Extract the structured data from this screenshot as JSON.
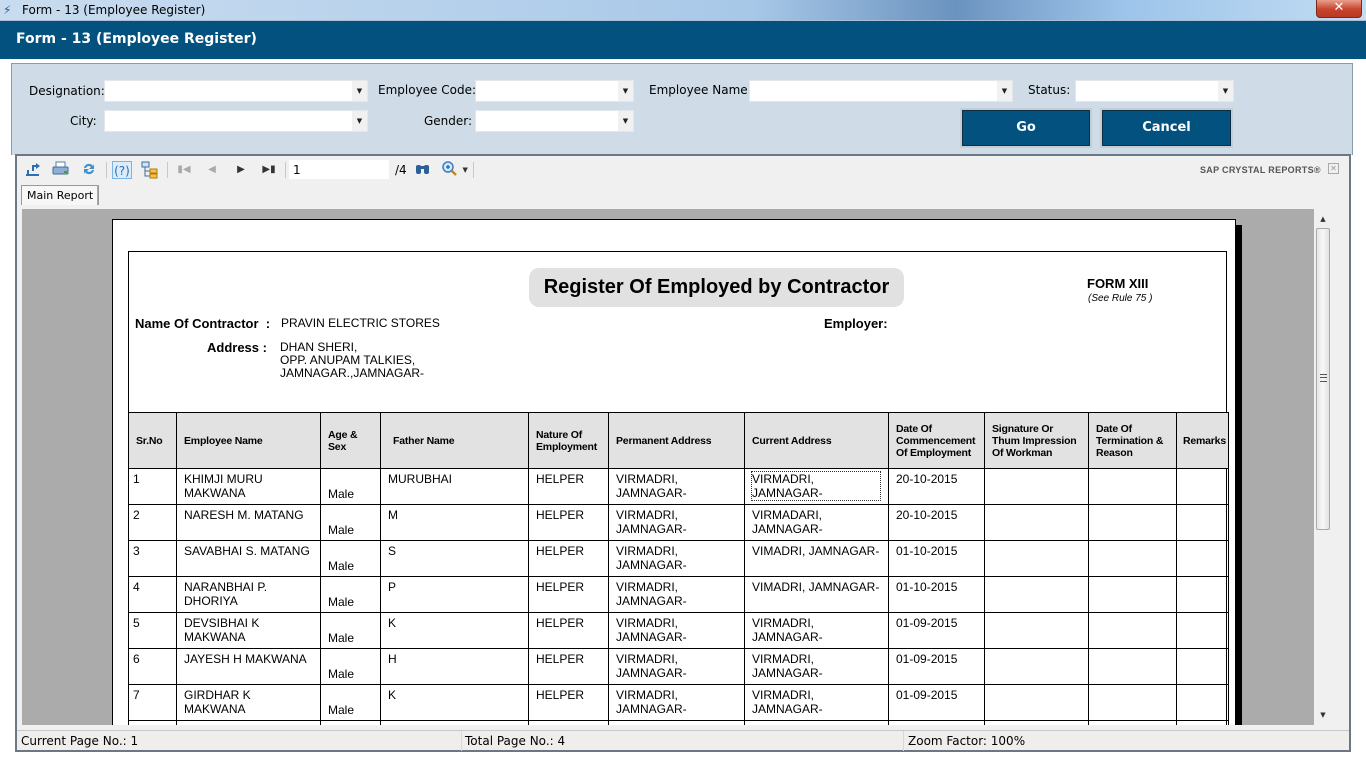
{
  "window": {
    "title": "Form - 13 (Employee Register)",
    "close_label": "✕"
  },
  "header": {
    "title": "Form - 13 (Employee Register)"
  },
  "filters": {
    "designation": {
      "label": "Designation:",
      "value": ""
    },
    "employee_code": {
      "label": "Employee Code:",
      "value": ""
    },
    "employee_name": {
      "label": "Employee Name:",
      "value": ""
    },
    "status": {
      "label": "Status:",
      "value": ""
    },
    "city": {
      "label": "City:",
      "value": ""
    },
    "gender": {
      "label": "Gender:",
      "value": ""
    },
    "go_label": "Go",
    "cancel_label": "Cancel"
  },
  "viewer": {
    "toolbar": {
      "export_icon": "export-icon",
      "print_icon": "print-icon",
      "refresh_icon": "refresh-icon",
      "help_icon": "help-icon",
      "group_tree_icon": "group-tree-icon",
      "current_page": "1",
      "total_pages": "/4",
      "find_icon": "binoculars-icon",
      "zoom_icon": "zoom-icon"
    },
    "brand": "SAP CRYSTAL REPORTS®",
    "tab": "Main Report",
    "status": {
      "current_page": "Current Page No.: 1",
      "total_pages": "Total Page No.: 4",
      "zoom": "Zoom Factor: 100%"
    }
  },
  "report": {
    "title": "Register Of Employed by Contractor",
    "form_no": "FORM XIII",
    "form_rule": "(See Rule 75 )",
    "contractor_label": "Name Of Contractor  :",
    "contractor_value": "PRAVIN ELECTRIC STORES",
    "employer_label": "Employer:",
    "address_label": "Address :",
    "address_lines": [
      "DHAN SHERI,",
      "OPP. ANUPAM TALKIES,",
      "JAMNAGAR.,JAMNAGAR-"
    ],
    "columns": [
      "Sr.No",
      "Employee Name",
      "Age & Sex",
      "Father Name",
      "Nature Of Employment",
      "Permanent Address",
      "Current Address",
      "Date Of Commencement Of Employment",
      "Signature Or Thum Impression Of Workman",
      "Date Of Termination & Reason",
      "Remarks"
    ],
    "rows": [
      {
        "sr": "1",
        "name": "KHIMJI MURU MAKWANA",
        "sex": "Male",
        "father": "MURUBHAI",
        "nature": "HELPER",
        "perm": "VIRMADRI, JAMNAGAR-",
        "curr": "VIRMADRI, JAMNAGAR-",
        "date": "20-10-2015",
        "sign": "",
        "term": "",
        "remarks": ""
      },
      {
        "sr": "2",
        "name": "NARESH M. MATANG",
        "sex": "Male",
        "father": "M",
        "nature": "HELPER",
        "perm": "VIRMADRI, JAMNAGAR-",
        "curr": "VIRMADARI, JAMNAGAR-",
        "date": "20-10-2015",
        "sign": "",
        "term": "",
        "remarks": ""
      },
      {
        "sr": "3",
        "name": "SAVABHAI S. MATANG",
        "sex": "Male",
        "father": "S",
        "nature": "HELPER",
        "perm": "VIRMADRI, JAMNAGAR-",
        "curr": "VIMADRI, JAMNAGAR-",
        "date": "01-10-2015",
        "sign": "",
        "term": "",
        "remarks": ""
      },
      {
        "sr": "4",
        "name": "NARANBHAI P. DHORIYA",
        "sex": "Male",
        "father": "P",
        "nature": "HELPER",
        "perm": "VIRMADRI, JAMNAGAR-",
        "curr": "VIMADRI, JAMNAGAR-",
        "date": "01-10-2015",
        "sign": "",
        "term": "",
        "remarks": ""
      },
      {
        "sr": "5",
        "name": "DEVSIBHAI K MAKWANA",
        "sex": "Male",
        "father": "K",
        "nature": "HELPER",
        "perm": "VIRMADRI, JAMNAGAR-",
        "curr": "VIRMADRI, JAMNAGAR-",
        "date": "01-09-2015",
        "sign": "",
        "term": "",
        "remarks": ""
      },
      {
        "sr": "6",
        "name": "JAYESH H MAKWANA",
        "sex": "Male",
        "father": "H",
        "nature": "HELPER",
        "perm": "VIRMADRI, JAMNAGAR-",
        "curr": "VIRMADRI, JAMNAGAR-",
        "date": "01-09-2015",
        "sign": "",
        "term": "",
        "remarks": ""
      },
      {
        "sr": "7",
        "name": "GIRDHAR K MAKWANA",
        "sex": "Male",
        "father": "K",
        "nature": "HELPER",
        "perm": "VIRMADRI, JAMNAGAR-",
        "curr": "VIRMADRI, JAMNAGAR-",
        "date": "01-09-2015",
        "sign": "",
        "term": "",
        "remarks": ""
      },
      {
        "sr": "",
        "name": "",
        "sex": "",
        "father": "",
        "nature": "",
        "perm": "",
        "curr": "",
        "date": "",
        "sign": "",
        "term": "",
        "remarks": ""
      }
    ]
  }
}
